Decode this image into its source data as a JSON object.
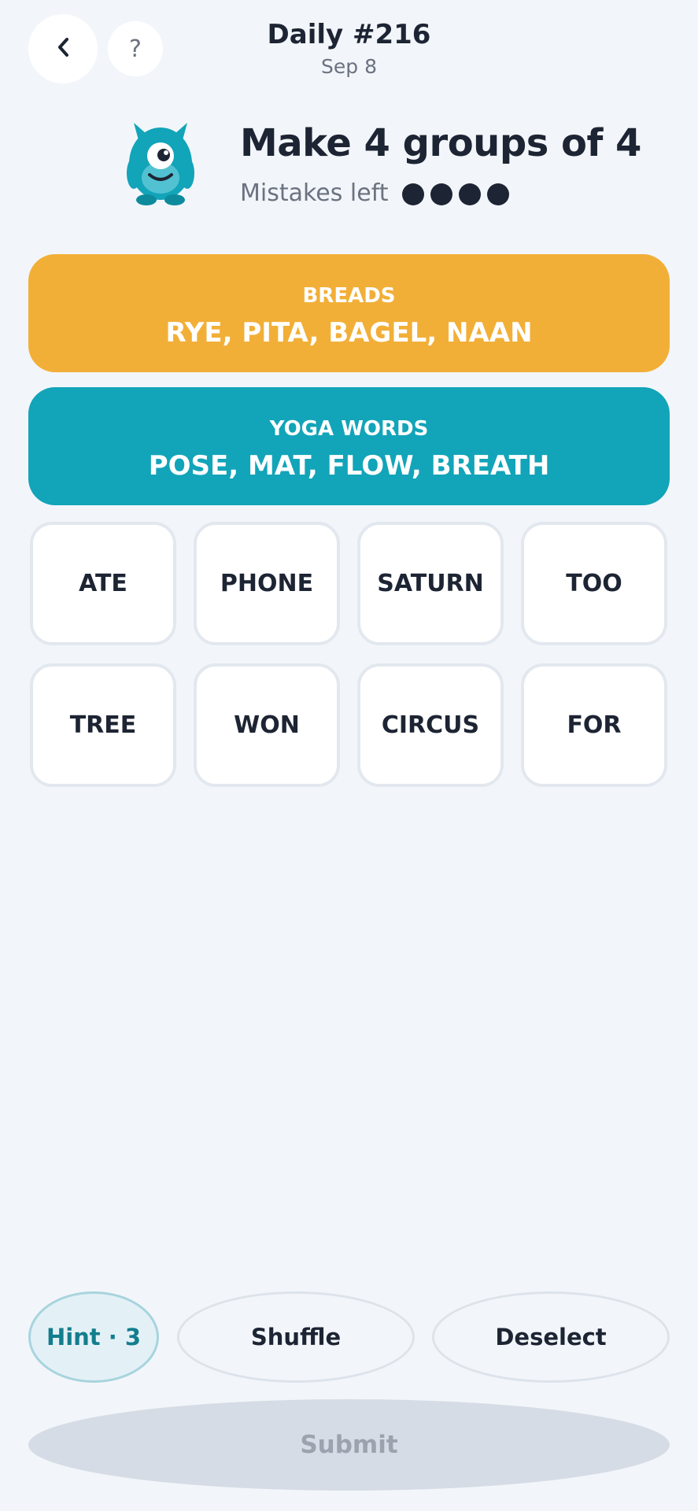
{
  "header": {
    "title": "Daily #216",
    "date": "Sep 8",
    "help_label": "?"
  },
  "intro": {
    "heading": "Make 4 groups of 4",
    "mistakes_label": "Mistakes left",
    "mistakes_remaining": 4
  },
  "solved_groups": [
    {
      "title": "BREADS",
      "words": "RYE, PITA, BAGEL, NAAN",
      "color": "#f2af37"
    },
    {
      "title": "YOGA WORDS",
      "words": "POSE, MAT, FLOW, BREATH",
      "color": "#12a4b9"
    }
  ],
  "tiles": [
    "ATE",
    "PHONE",
    "SATURN",
    "TOO",
    "TREE",
    "WON",
    "CIRCUS",
    "FOR"
  ],
  "controls": {
    "hint_label": "Hint · 3",
    "shuffle_label": "Shuffle",
    "deselect_label": "Deselect",
    "submit_label": "Submit"
  },
  "colors": {
    "background": "#f2f6fa",
    "text": "#1d2433",
    "accent": "#137d8d"
  },
  "icons": {
    "back": "chevron-left-icon",
    "help": "question-mark-icon",
    "mascot": "one-eyed-monster-mascot"
  }
}
